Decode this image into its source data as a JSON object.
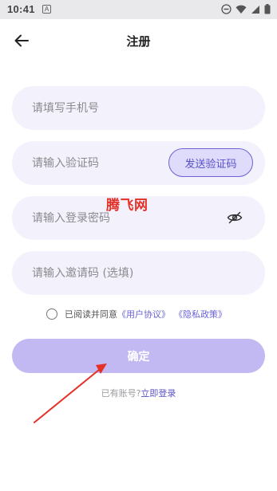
{
  "status_bar": {
    "time": "10:41",
    "notification_letter": "A",
    "icons": [
      "dnd-icon",
      "wifi-icon",
      "signal-icon",
      "battery-icon"
    ]
  },
  "header": {
    "title": "注册",
    "back_icon": "back-arrow-icon"
  },
  "form": {
    "phone_placeholder": "请填写手机号",
    "code_placeholder": "请输入验证码",
    "send_code_label": "发送验证码",
    "password_placeholder": "请输入登录密码",
    "password_toggle_icon": "eye-off-icon",
    "invite_placeholder": "请输入邀请码 (选填)"
  },
  "watermark": "腾飞网",
  "agreement": {
    "prefix": "已阅读并同意",
    "user_agreement": "《用户协议》",
    "privacy_policy": "《隐私政策》"
  },
  "confirm_label": "确定",
  "login": {
    "prompt": "已有账号?",
    "link": "立即登录"
  },
  "colors": {
    "accent": "#6a63d6",
    "field_bg": "#f3f2fc",
    "button_bg": "#c2b8f2",
    "annotation_red": "#e53027"
  }
}
